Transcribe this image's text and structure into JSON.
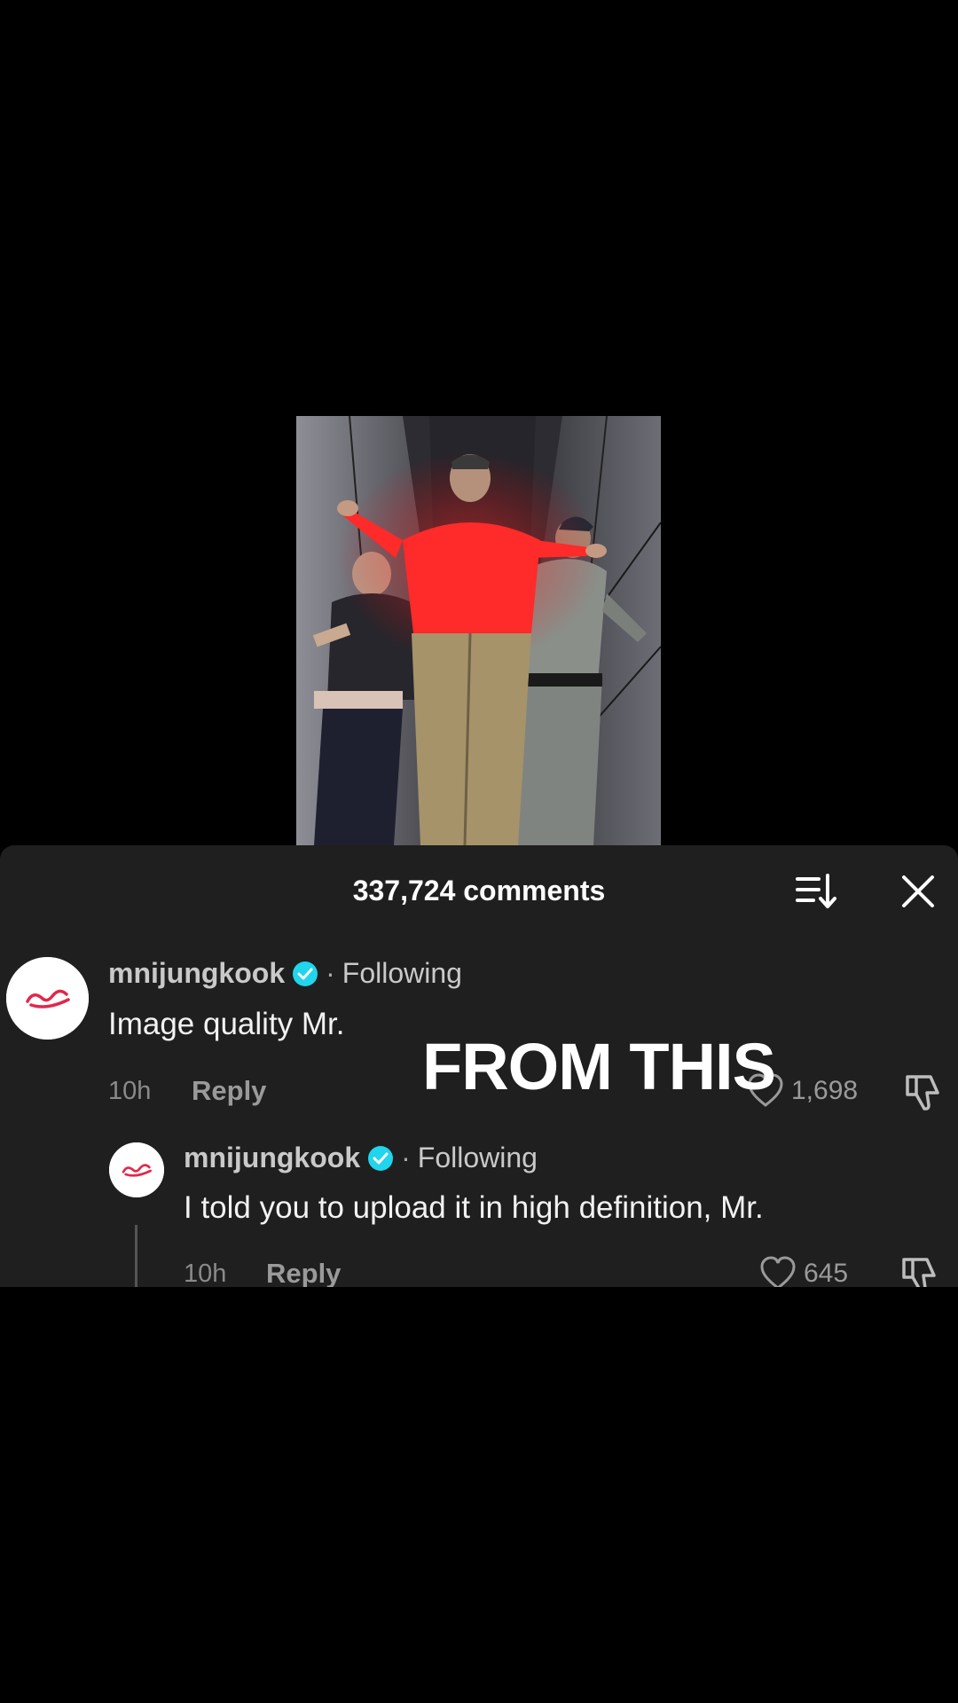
{
  "video": {
    "subject": "three people dancing in a hallway, center person in red jacket"
  },
  "comments_sheet": {
    "count_label": "337,724 comments",
    "sort_icon": "sort-icon",
    "close_icon": "close-icon",
    "comments": [
      {
        "username": "mnijungkook",
        "separator": "·",
        "relation": "Following",
        "text": "Image quality Mr.",
        "time": "10h",
        "reply_label": "Reply",
        "likes": "1,698"
      },
      {
        "username": "mnijungkook",
        "separator": "·",
        "relation": "Following",
        "text": "I told you to upload it in high definition, Mr.",
        "time": "10h",
        "reply_label": "Reply",
        "likes": "645"
      }
    ]
  },
  "overlay": {
    "caption": "FROM THIS"
  },
  "colors": {
    "background": "#000000",
    "sheet": "#1f1f1f",
    "verified": "#20d5ec",
    "avatar_logo": "#e0284a"
  }
}
